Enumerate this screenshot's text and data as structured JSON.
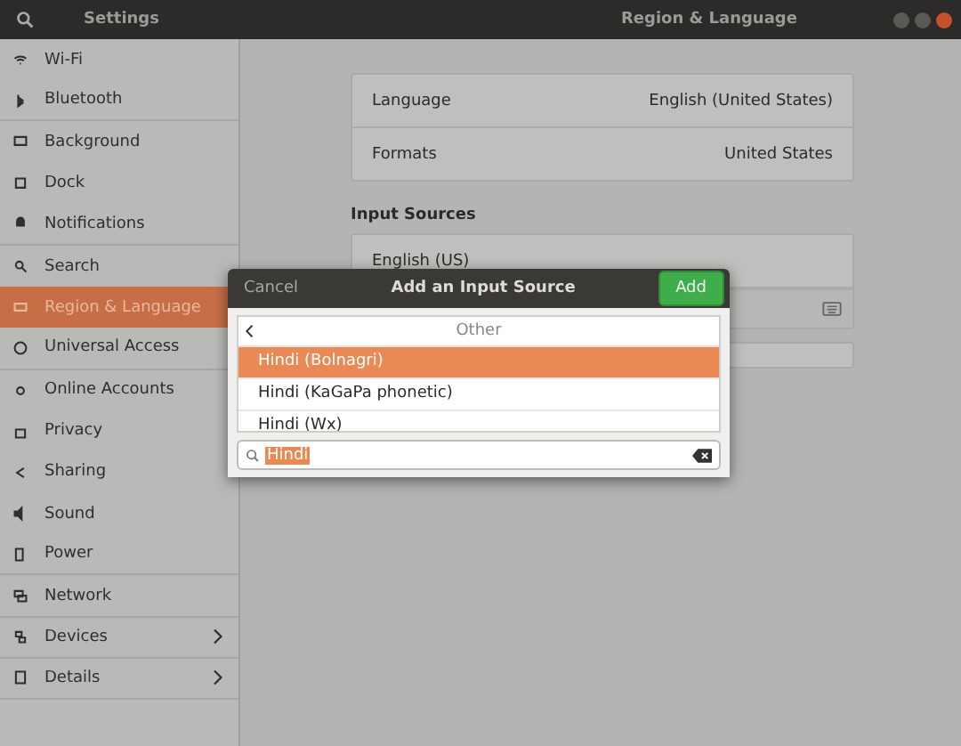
{
  "header": {
    "app_title": "Settings",
    "page_title": "Region & Language"
  },
  "sidebar": {
    "items": [
      {
        "label": "Wi-Fi",
        "selected": false,
        "arrow": false
      },
      {
        "label": "Bluetooth",
        "selected": false,
        "arrow": false
      },
      {
        "label": "Background",
        "selected": false,
        "arrow": false
      },
      {
        "label": "Dock",
        "selected": false,
        "arrow": false
      },
      {
        "label": "Notifications",
        "selected": false,
        "arrow": false
      },
      {
        "label": "Search",
        "selected": false,
        "arrow": false
      },
      {
        "label": "Region & Language",
        "selected": true,
        "arrow": false
      },
      {
        "label": "Universal Access",
        "selected": false,
        "arrow": false
      },
      {
        "label": "Online Accounts",
        "selected": false,
        "arrow": false
      },
      {
        "label": "Privacy",
        "selected": false,
        "arrow": false
      },
      {
        "label": "Sharing",
        "selected": false,
        "arrow": false
      },
      {
        "label": "Sound",
        "selected": false,
        "arrow": false
      },
      {
        "label": "Power",
        "selected": false,
        "arrow": false
      },
      {
        "label": "Network",
        "selected": false,
        "arrow": false
      },
      {
        "label": "Devices",
        "selected": false,
        "arrow": true
      },
      {
        "label": "Details",
        "selected": false,
        "arrow": true
      }
    ]
  },
  "settings": [
    {
      "label": "Language",
      "value": "English (United States)"
    },
    {
      "label": "Formats",
      "value": "United States"
    }
  ],
  "input_sources": {
    "heading": "Input Sources",
    "items": [
      "English (US)"
    ]
  },
  "dialog": {
    "cancel": "Cancel",
    "title": "Add an Input Source",
    "add": "Add",
    "back_label": "Other",
    "options": [
      {
        "label": "Hindi (Bolnagri)",
        "selected": true
      },
      {
        "label": "Hindi (KaGaPa phonetic)",
        "selected": false
      },
      {
        "label": "Hindi (Wx)",
        "selected": false
      }
    ],
    "search": {
      "value": "Hindi"
    }
  }
}
